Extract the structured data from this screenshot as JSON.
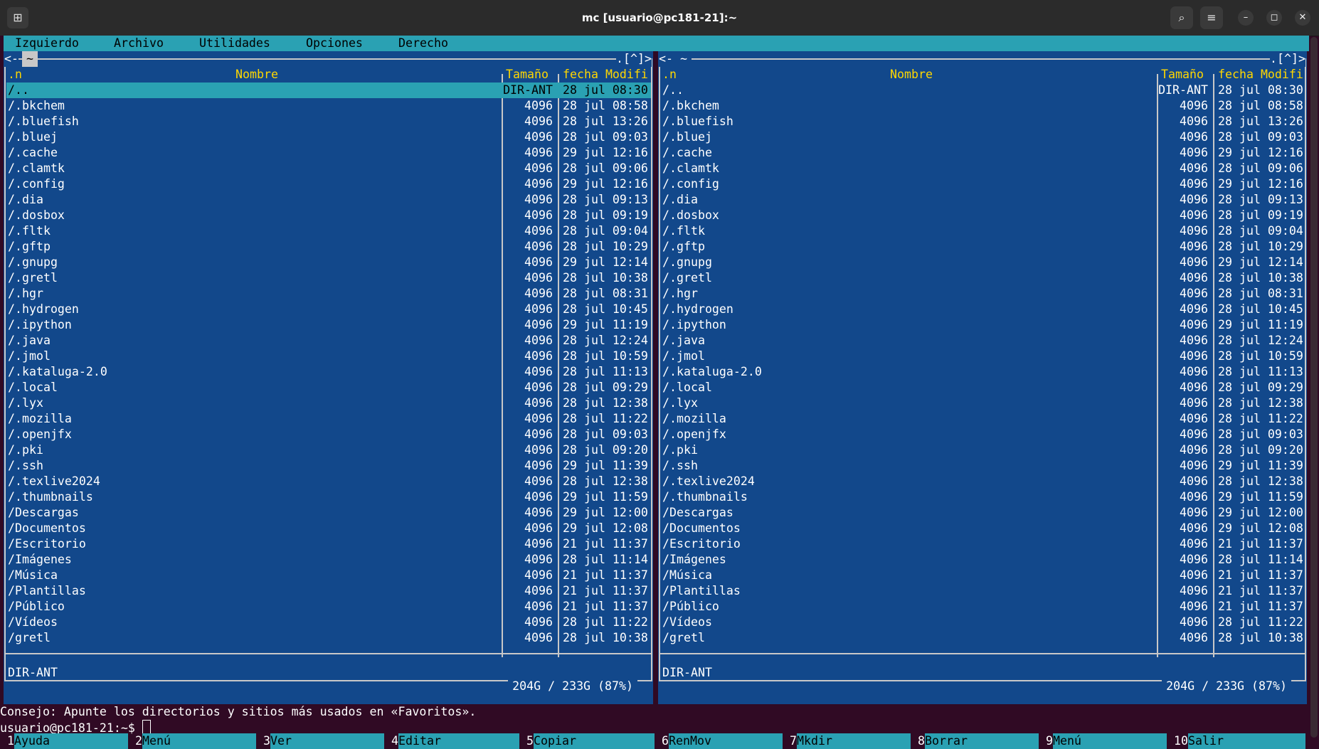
{
  "window": {
    "title": "mc [usuario@pc181-21]:~"
  },
  "menu": [
    "Izquierdo",
    "Archivo",
    "Utilidades",
    "Opciones",
    "Derecho"
  ],
  "left_panel": {
    "path_label": "~",
    "corner_left": "<-",
    "corner_right": ".[^]>",
    "columns": {
      "sort": ".n",
      "name": "Nombre",
      "size": "Tamaño",
      "date": "fecha Modifi"
    },
    "status": "DIR-ANT",
    "disk": "204G / 233G (87%)"
  },
  "right_panel": {
    "path_label": "<- ~",
    "corner_right": ".[^]>",
    "columns": {
      "sort": ".n",
      "name": "Nombre",
      "size": "Tamaño",
      "date": "fecha Modifi"
    },
    "status": "DIR-ANT",
    "disk": "204G / 233G (87%)"
  },
  "files": [
    {
      "name": "/..",
      "size": "DIR-ANT",
      "date": "28 jul 08:30"
    },
    {
      "name": "/.bkchem",
      "size": "4096",
      "date": "28 jul 08:58"
    },
    {
      "name": "/.bluefish",
      "size": "4096",
      "date": "28 jul 13:26"
    },
    {
      "name": "/.bluej",
      "size": "4096",
      "date": "28 jul 09:03"
    },
    {
      "name": "/.cache",
      "size": "4096",
      "date": "29 jul 12:16"
    },
    {
      "name": "/.clamtk",
      "size": "4096",
      "date": "28 jul 09:06"
    },
    {
      "name": "/.config",
      "size": "4096",
      "date": "29 jul 12:16"
    },
    {
      "name": "/.dia",
      "size": "4096",
      "date": "28 jul 09:13"
    },
    {
      "name": "/.dosbox",
      "size": "4096",
      "date": "28 jul 09:19"
    },
    {
      "name": "/.fltk",
      "size": "4096",
      "date": "28 jul 09:04"
    },
    {
      "name": "/.gftp",
      "size": "4096",
      "date": "28 jul 10:29"
    },
    {
      "name": "/.gnupg",
      "size": "4096",
      "date": "29 jul 12:14"
    },
    {
      "name": "/.gretl",
      "size": "4096",
      "date": "28 jul 10:38"
    },
    {
      "name": "/.hgr",
      "size": "4096",
      "date": "28 jul 08:31"
    },
    {
      "name": "/.hydrogen",
      "size": "4096",
      "date": "28 jul 10:45"
    },
    {
      "name": "/.ipython",
      "size": "4096",
      "date": "29 jul 11:19"
    },
    {
      "name": "/.java",
      "size": "4096",
      "date": "28 jul 12:24"
    },
    {
      "name": "/.jmol",
      "size": "4096",
      "date": "28 jul 10:59"
    },
    {
      "name": "/.kataluga-2.0",
      "size": "4096",
      "date": "28 jul 11:13"
    },
    {
      "name": "/.local",
      "size": "4096",
      "date": "28 jul 09:29"
    },
    {
      "name": "/.lyx",
      "size": "4096",
      "date": "28 jul 12:38"
    },
    {
      "name": "/.mozilla",
      "size": "4096",
      "date": "28 jul 11:22"
    },
    {
      "name": "/.openjfx",
      "size": "4096",
      "date": "28 jul 09:03"
    },
    {
      "name": "/.pki",
      "size": "4096",
      "date": "28 jul 09:20"
    },
    {
      "name": "/.ssh",
      "size": "4096",
      "date": "29 jul 11:39"
    },
    {
      "name": "/.texlive2024",
      "size": "4096",
      "date": "28 jul 12:38"
    },
    {
      "name": "/.thumbnails",
      "size": "4096",
      "date": "29 jul 11:59"
    },
    {
      "name": "/Descargas",
      "size": "4096",
      "date": "29 jul 12:00"
    },
    {
      "name": "/Documentos",
      "size": "4096",
      "date": "29 jul 12:08"
    },
    {
      "name": "/Escritorio",
      "size": "4096",
      "date": "21 jul 11:37"
    },
    {
      "name": "/Imágenes",
      "size": "4096",
      "date": "28 jul 11:14"
    },
    {
      "name": "/Música",
      "size": "4096",
      "date": "21 jul 11:37"
    },
    {
      "name": "/Plantillas",
      "size": "4096",
      "date": "21 jul 11:37"
    },
    {
      "name": "/Público",
      "size": "4096",
      "date": "21 jul 11:37"
    },
    {
      "name": "/Vídeos",
      "size": "4096",
      "date": "28 jul 11:22"
    },
    {
      "name": "/gretl",
      "size": "4096",
      "date": "28 jul 10:38"
    }
  ],
  "tip": "Consejo: Apunte los directorios y sitios más usados en «Favoritos».",
  "prompt": "usuario@pc181-21:~$ ",
  "fkeys": [
    {
      "num": "1",
      "label": "Ayuda"
    },
    {
      "num": "2",
      "label": "Menú"
    },
    {
      "num": "3",
      "label": "Ver"
    },
    {
      "num": "4",
      "label": "Editar"
    },
    {
      "num": "5",
      "label": "Copiar"
    },
    {
      "num": "6",
      "label": "RenMov"
    },
    {
      "num": "7",
      "label": "Mkdir"
    },
    {
      "num": "8",
      "label": "Borrar"
    },
    {
      "num": "9",
      "label": "Menú"
    },
    {
      "num": "10",
      "label": "Salir"
    }
  ],
  "icons": {
    "new_tab": "new-tab-icon",
    "search": "search-icon",
    "menu": "hamburger-icon",
    "minimize": "minimize-icon",
    "maximize": "maximize-icon",
    "close": "close-icon"
  },
  "colors": {
    "panel_bg": "#12488b",
    "selection": "#2aa1b3",
    "header_text": "#ffd700",
    "terminal_bg": "#300a24"
  }
}
